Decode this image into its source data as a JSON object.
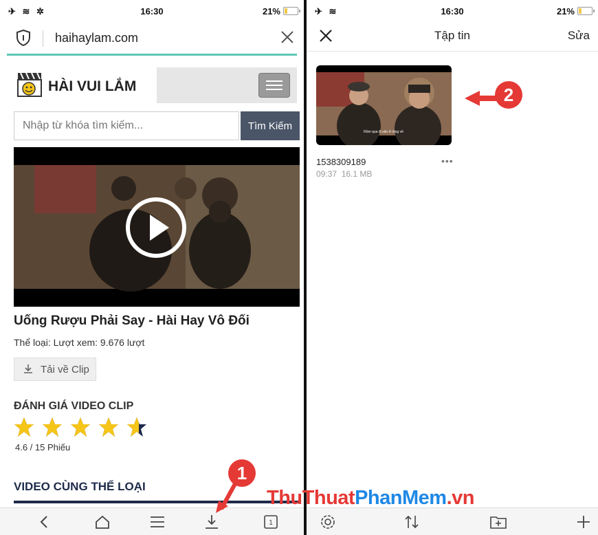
{
  "left": {
    "status": {
      "time": "16:30",
      "battery": "21%",
      "battery_level": 0.21
    },
    "url": "haihaylam.com",
    "site": {
      "logo_text": "HÀI VUI LẮM"
    },
    "search": {
      "placeholder": "Nhập từ khóa tìm kiếm...",
      "button": "Tìm Kiếm"
    },
    "video": {
      "title": "Uống Rượu Phải Say - Hài Hay Vô Đối",
      "meta": "Thể loại: Lượt xem: 9.676 lượt",
      "download_label": "Tải về Clip"
    },
    "rating": {
      "heading": "ĐÁNH GIÁ VIDEO CLIP",
      "stars": 4.6,
      "max_stars": 5,
      "summary": "4.6 / 15 Phiếu"
    },
    "related_heading": "VIDEO CÙNG THỂ LOẠI",
    "toolbar": [
      "back-icon",
      "home-icon",
      "menu-icon",
      "download-icon",
      "tabs-icon"
    ],
    "tabs_count": "1"
  },
  "right": {
    "status": {
      "time": "16:30",
      "battery": "21%",
      "battery_level": 0.21
    },
    "nav": {
      "title": "Tập tin",
      "edit": "Sửa"
    },
    "file": {
      "name": "1538309189",
      "time": "09:37",
      "size": "16.1 MB",
      "caption": "Rồm qua đi sân ở răng về"
    },
    "toolbar": [
      "settings-icon",
      "sort-icon",
      "new-folder-icon",
      "add-icon"
    ]
  },
  "callouts": {
    "one": "1",
    "two": "2"
  },
  "watermark": {
    "part1": "ThuThuat",
    "part2": "PhanMem",
    "part3": ".vn"
  },
  "colors": {
    "accent_line": "#5dc6b5",
    "star": "#f5c518",
    "callout": "#e53935",
    "search_button": "#4a5568"
  }
}
